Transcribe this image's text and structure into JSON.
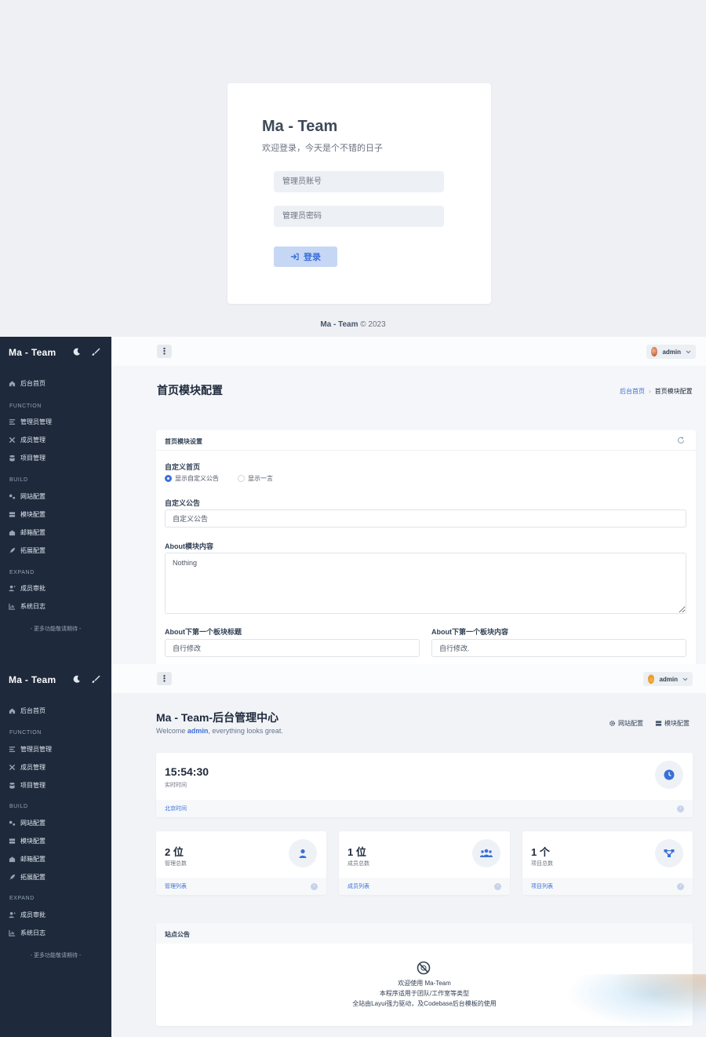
{
  "login": {
    "title": "Ma - Team",
    "subtitle": "欢迎登录，今天是个不错的日子",
    "account_placeholder": "管理员账号",
    "password_placeholder": "管理员密码",
    "login_label": "登录",
    "footer_brand": "Ma - Team",
    "footer_rest": " © 2023"
  },
  "sidebar": {
    "brand": "Ma - Team",
    "home": "后台首页",
    "sections": [
      {
        "heading": "FUNCTION",
        "items": [
          "管理员管理",
          "成员管理",
          "项目管理"
        ]
      },
      {
        "heading": "BUILD",
        "items": [
          "网站配置",
          "模块配置",
          "邮箱配置",
          "拓展配置"
        ]
      },
      {
        "heading": "EXPAND",
        "items": [
          "成员审批",
          "系统日志"
        ]
      }
    ],
    "more": "- 更多功能敬请期待 -"
  },
  "user": {
    "name": "admin"
  },
  "config_page": {
    "title": "首页模块配置",
    "breadcrumb": [
      "后台首页",
      "首页模块配置"
    ],
    "card_title": "首页模块设置",
    "custom_home_label": "自定义首页",
    "radio_options": [
      "显示自定义公告",
      "显示一言"
    ],
    "radio_selected": 0,
    "custom_notice_label": "自定义公告",
    "custom_notice_value": "自定义公告",
    "about_label": "About模块内容",
    "about_value": "Nothing",
    "first_title_label": "About下第一个板块标题",
    "first_title_value": "自行修改",
    "first_content_label": "About下第一个板块内容",
    "first_content_value": "自行修改."
  },
  "dashboard": {
    "title": "Ma - Team-后台管理中心",
    "welcome_pre": "Welcome ",
    "welcome_user": "admin",
    "welcome_post": ", everything looks great.",
    "action_site": "网站配置",
    "action_module": "模块配置",
    "time": "15:54:30",
    "time_label": "实时时间",
    "time_footer": "北京时间",
    "stats": [
      {
        "value": "2 位",
        "label": "管理总数",
        "link": "管理列表",
        "icon": "user-icon"
      },
      {
        "value": "1 位",
        "label": "成员总数",
        "link": "成员列表",
        "icon": "users-icon"
      },
      {
        "value": "1 个",
        "label": "项目总数",
        "link": "项目列表",
        "icon": "sitemap-icon"
      }
    ],
    "notice_title": "站点公告",
    "notice_lines": [
      "欢迎使用 Ma-Team",
      "本程序适用于团队/工作室等类型",
      "全站由Layui强力驱动，及Codebase后台模板的使用"
    ]
  }
}
